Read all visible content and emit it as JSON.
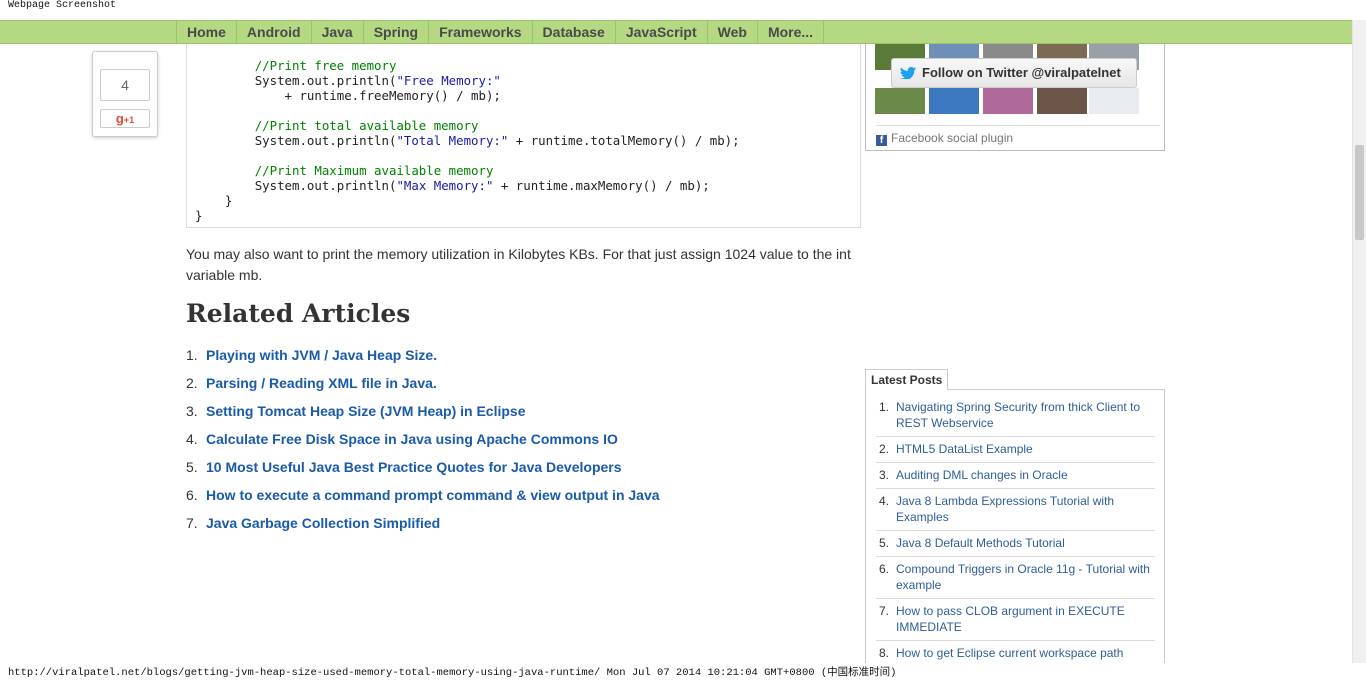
{
  "header_label": "Webpage Screenshot",
  "nav": {
    "items": [
      {
        "label": "Home"
      },
      {
        "label": "Android"
      },
      {
        "label": "Java"
      },
      {
        "label": "Spring"
      },
      {
        "label": "Frameworks"
      },
      {
        "label": "Database"
      },
      {
        "label": "JavaScript"
      },
      {
        "label": "Web"
      },
      {
        "label": "More..."
      }
    ]
  },
  "share": {
    "count": "4",
    "gplus_label": "g",
    "gplus_suffix": "+1"
  },
  "code": {
    "lines": [
      {
        "indent": "        ",
        "comment": "//Print free memory"
      },
      {
        "indent": "        ",
        "pre": "System.out.println(",
        "str": "\"Free Memory:\"",
        "post": ""
      },
      {
        "indent": "            ",
        "pre": "+ runtime.freeMemory() / mb);",
        "str": "",
        "post": ""
      },
      {
        "indent": "",
        "pre": "",
        "str": "",
        "post": ""
      },
      {
        "indent": "        ",
        "comment": "//Print total available memory"
      },
      {
        "indent": "        ",
        "pre": "System.out.println(",
        "str": "\"Total Memory:\"",
        "post": " + runtime.totalMemory() / mb);"
      },
      {
        "indent": "",
        "pre": "",
        "str": "",
        "post": ""
      },
      {
        "indent": "        ",
        "comment": "//Print Maximum available memory"
      },
      {
        "indent": "        ",
        "pre": "System.out.println(",
        "str": "\"Max Memory:\"",
        "post": " + runtime.maxMemory() / mb);"
      },
      {
        "indent": "    ",
        "pre": "}",
        "str": "",
        "post": ""
      },
      {
        "indent": "",
        "pre": "}",
        "str": "",
        "post": ""
      }
    ]
  },
  "paragraph": "You may also want to print the memory utilization in Kilobytes KBs. For that just assign 1024 value to the int variable mb.",
  "related": {
    "heading": "Related Articles",
    "items": [
      {
        "num": "1.",
        "title": "Playing with JVM / Java Heap Size."
      },
      {
        "num": "2.",
        "title": "Parsing / Reading XML file in Java."
      },
      {
        "num": "3.",
        "title": "Setting Tomcat Heap Size (JVM Heap) in Eclipse"
      },
      {
        "num": "4.",
        "title": "Calculate Free Disk Space in Java using Apache Commons IO"
      },
      {
        "num": "5.",
        "title": "10 Most Useful Java Best Practice Quotes for Java Developers"
      },
      {
        "num": "6.",
        "title": "How to execute a command prompt command & view output in Java"
      },
      {
        "num": "7.",
        "title": "Java Garbage Collection Simplified"
      }
    ]
  },
  "social": {
    "twitter_follow": "Follow on Twitter @viralpatelnet",
    "twitter_icon": "twitter-bird-icon",
    "facebook_plugin": "Facebook social plugin",
    "facebook_icon": "facebook-icon"
  },
  "latest_posts": {
    "tab_label": "Latest Posts",
    "items": [
      {
        "num": "1.",
        "title": "Navigating Spring Security from thick Client to REST Webservice"
      },
      {
        "num": "2.",
        "title": "HTML5 DataList Example"
      },
      {
        "num": "3.",
        "title": "Auditing DML changes in Oracle"
      },
      {
        "num": "4.",
        "title": "Java 8 Lambda Expressions Tutorial with Examples"
      },
      {
        "num": "5.",
        "title": "Java 8 Default Methods Tutorial"
      },
      {
        "num": "6.",
        "title": "Compound Triggers in Oracle 11g - Tutorial with example"
      },
      {
        "num": "7.",
        "title": "How to pass CLOB argument in EXECUTE IMMEDIATE"
      },
      {
        "num": "8.",
        "title": "How to get Eclipse current workspace path"
      }
    ]
  },
  "status": {
    "url": "http://viralpatel.net/blogs/getting-jvm-heap-size-used-memory-total-memory-using-java-runtime/",
    "timestamp": "Mon Jul 07 2014 10:21:04 GMT+0800 (中国标准时间)"
  },
  "colors": {
    "nav_bg": "#b5d883",
    "link": "#1a5aab",
    "code_comment": "#008200",
    "code_string": "#1a1aa6"
  }
}
